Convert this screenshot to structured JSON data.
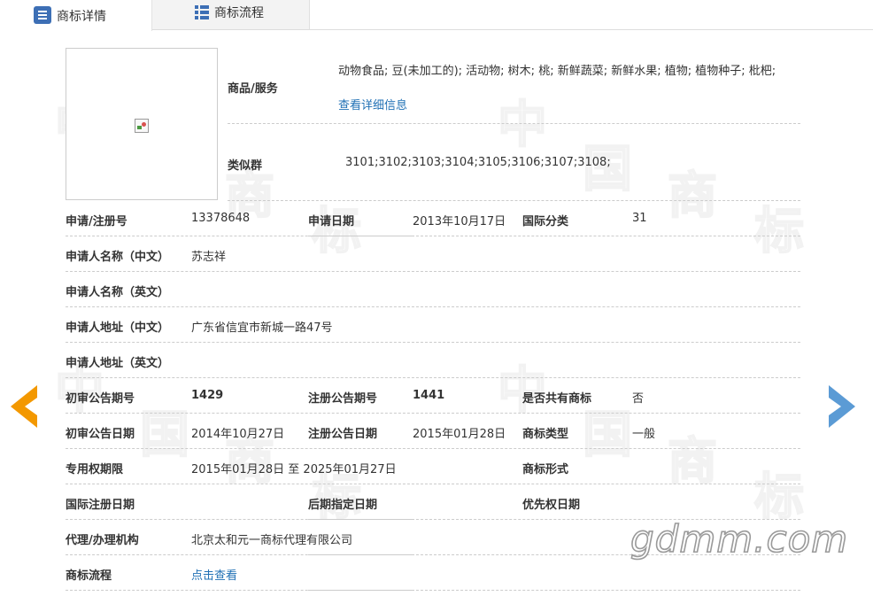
{
  "tabs": {
    "detail": "商标详情",
    "flow": "商标流程"
  },
  "watermark": {
    "chars": [
      "中",
      "国",
      "商",
      "标",
      "中",
      "国",
      "商",
      "标",
      "中",
      "国",
      "商",
      "标",
      "中",
      "国",
      "商",
      "标"
    ]
  },
  "goods": {
    "label": "商品/服务",
    "value": "动物食品; 豆(未加工的); 活动物; 树木; 桃; 新鲜蔬菜; 新鲜水果; 植物; 植物种子; 枇杷;",
    "link": "查看详细信息"
  },
  "similar": {
    "label": "类似群",
    "value": "3101;3102;3103;3104;3105;3106;3107;3108;"
  },
  "fields": {
    "reg_no_label": "申请/注册号",
    "reg_no": "13378648",
    "apply_date_label": "申请日期",
    "apply_date": "2013年10月17日",
    "intl_class_label": "国际分类",
    "intl_class": "31",
    "applicant_cn_label": "申请人名称（中文）",
    "applicant_cn": "苏志祥",
    "applicant_en_label": "申请人名称（英文）",
    "applicant_en": "",
    "address_cn_label": "申请人地址（中文）",
    "address_cn": "广东省信宜市新城一路47号",
    "address_en_label": "申请人地址（英文）",
    "address_en": "",
    "prelim_no_label": "初审公告期号",
    "prelim_no": "1429",
    "reg_pub_no_label": "注册公告期号",
    "reg_pub_no": "1441",
    "shared_label": "是否共有商标",
    "shared": "否",
    "prelim_date_label": "初审公告日期",
    "prelim_date": "2014年10月27日",
    "reg_pub_date_label": "注册公告日期",
    "reg_pub_date": "2015年01月28日",
    "tm_type_label": "商标类型",
    "tm_type": "一般",
    "exclusive_label": "专用权期限",
    "exclusive": "2015年01月28日 至 2025年01月27日",
    "tm_form_label": "商标形式",
    "tm_form": "",
    "intl_reg_date_label": "国际注册日期",
    "later_date_label": "后期指定日期",
    "priority_date_label": "优先权日期",
    "agent_label": "代理/办理机构",
    "agent": "北京太和元一商标代理有限公司",
    "flow_label": "商标流程",
    "flow_link": "点击查看"
  },
  "brand_watermark": "gdmm.com",
  "colors": {
    "accent": "#2171b5",
    "arrow_left": "#f39800",
    "arrow_right": "#5b9bd5"
  }
}
